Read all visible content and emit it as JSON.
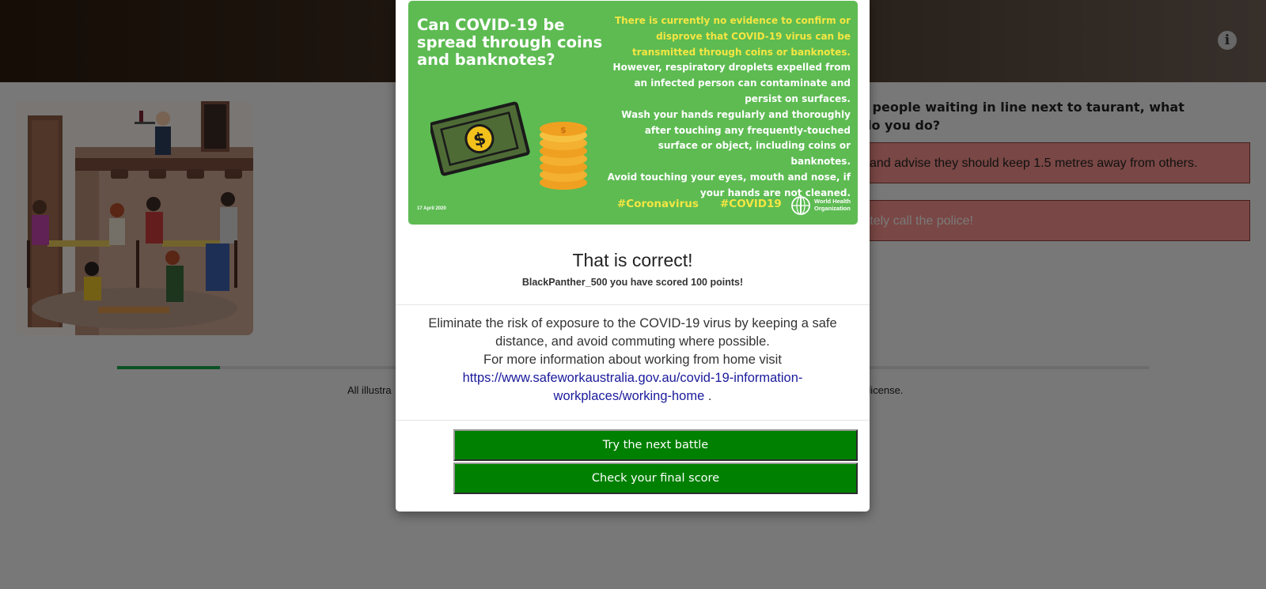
{
  "background": {
    "question_fragment": "f people waiting in line next to taurant, what do you do?",
    "answers": [
      "and advise they should keep 1.5 metres away from others.",
      "ediately call the police!"
    ],
    "progress_fraction": 0.1,
    "footer_left": "All illustra",
    "footer_right": "se license."
  },
  "modal": {
    "poster": {
      "title": "Can COVID-19 be spread through coins and banknotes?",
      "highlight": "There is currently no evidence to confirm or disprove that COVID-19 virus can be transmitted through coins or banknotes.",
      "body": [
        "However, respiratory droplets expelled from an infected person can contaminate and persist on surfaces.",
        "Wash your hands regularly and thoroughly after touching any frequently-touched surface or object, including coins or banknotes.",
        "Avoid touching your eyes, mouth and nose, if your hands are not cleaned."
      ],
      "date": "17 April 2020",
      "tags": [
        "#Coronavirus",
        "#COVID19"
      ],
      "org_line1": "World Health",
      "org_line2": "Organization"
    },
    "result_title": "That is correct!",
    "result_score": "BlackPanther_500 you have scored 100 points!",
    "tip_text": "Eliminate the risk of exposure to the COVID-19 virus by keeping a safe distance, and avoid commuting where possible.",
    "more_info": "For more information about working from home visit",
    "link_url": "https://www.safeworkaustralia.gov.au/covid-19-information-workplaces/working-home",
    "link_suffix": " .",
    "buttons": {
      "next": "Try the next battle",
      "final": "Check your final score"
    }
  },
  "colors": {
    "poster_green": "#5dbb52",
    "button_green": "#008000",
    "answer_red": "#f28f8a"
  },
  "icons": [
    "info-icon",
    "banknote-icon",
    "coin-stack-icon",
    "who-logo-icon"
  ]
}
